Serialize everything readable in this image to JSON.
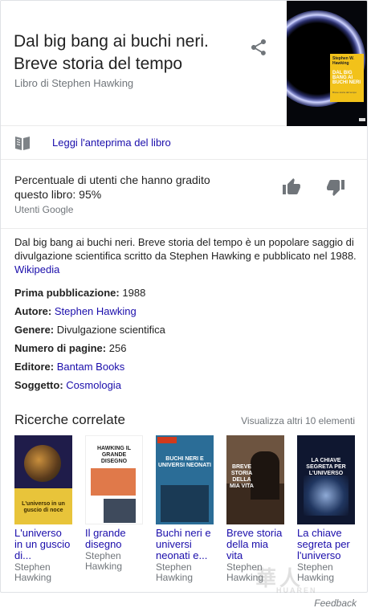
{
  "header": {
    "title": "Dal big bang ai buchi neri. Breve storia del tempo",
    "subtitle": "Libro di Stephen Hawking",
    "share_icon": "share-icon",
    "cover": {
      "author": "Stephen W. Hawking",
      "title": "DAL BIG BANG AI BUCHI NERI",
      "tagline": "Breve storia del tempo"
    }
  },
  "preview": {
    "icon": "open-book-icon",
    "label": "Leggi l'anteprima del libro"
  },
  "rating": {
    "text": "Percentuale di utenti che hanno gradito questo libro: 95%",
    "source": "Utenti Google",
    "thumbs_up_icon": "thumbs-up-icon",
    "thumbs_down_icon": "thumbs-down-icon"
  },
  "description": {
    "text": "Dal big bang ai buchi neri. Breve storia del tempo è un popolare saggio di divulgazione scientifica scritto da Stephen Hawking e pubblicato nel 1988.",
    "source_link": "Wikipedia"
  },
  "facts": [
    {
      "label": "Prima pubblicazione:",
      "value": "1988",
      "is_link": false
    },
    {
      "label": "Autore:",
      "value": "Stephen Hawking",
      "is_link": true
    },
    {
      "label": "Genere:",
      "value": "Divulgazione scientifica",
      "is_link": false
    },
    {
      "label": "Numero di pagine:",
      "value": "256",
      "is_link": false
    },
    {
      "label": "Editore:",
      "value": "Bantam Books",
      "is_link": true
    },
    {
      "label": "Soggetto:",
      "value": "Cosmologia",
      "is_link": true
    }
  ],
  "related": {
    "title": "Ricerche correlate",
    "more": "Visualizza altri 10 elementi",
    "items": [
      {
        "title": "L'universo in un guscio di...",
        "author": "Stephen Hawking",
        "cover_text": "L'universo in un guscio di noce"
      },
      {
        "title": "Il grande disegno",
        "author": "Stephen Hawking",
        "cover_text": "HAWKING IL GRANDE DISEGNO"
      },
      {
        "title": "Buchi neri e universi neonati e...",
        "author": "Stephen Hawking",
        "cover_text": "BUCHI NERI E UNIVERSI NEONATI"
      },
      {
        "title": "Breve storia della mia vita",
        "author": "Stephen Hawking",
        "cover_text": "BREVE STORIA DELLA MIA VITA"
      },
      {
        "title": "La chiave segreta per l'universo",
        "author": "Stephen Hawking",
        "cover_text": "LA CHIAVE SEGRETA PER L'UNIVERSO"
      }
    ]
  },
  "feedback": "Feedback",
  "colors": {
    "link": "#1a0dab",
    "secondary_text": "#70757a",
    "border": "#dfe1e5"
  }
}
